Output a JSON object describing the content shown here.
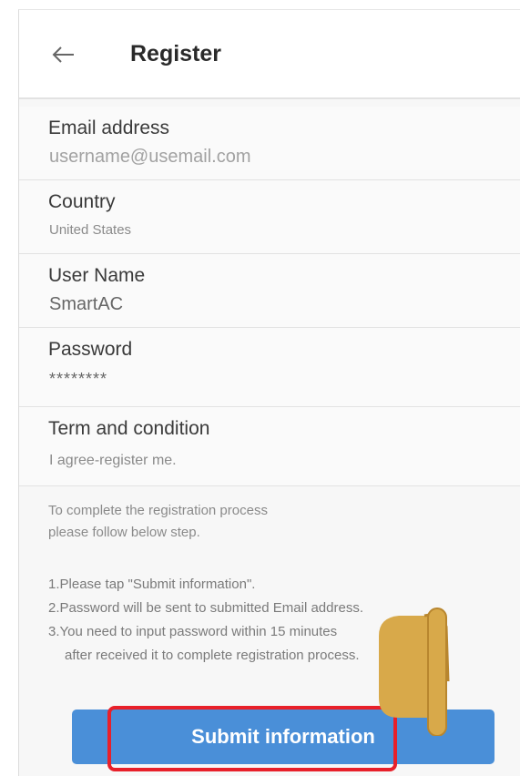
{
  "header": {
    "back_icon": "back-arrow-icon",
    "title": "Register"
  },
  "form": {
    "email": {
      "label": "Email address",
      "value": "username@usemail.com"
    },
    "country": {
      "label": "Country",
      "value": "United States"
    },
    "user_name": {
      "label": "User Name",
      "value": "SmartAC"
    },
    "password": {
      "label": "Password",
      "value": "********"
    },
    "terms": {
      "label": "Term and condition",
      "value": "I agree-register me."
    }
  },
  "instructions": {
    "line1": "To complete the registration process",
    "line2": "please follow below step.",
    "step1": "1.Please tap \"Submit information\".",
    "step2": "2.Password will be sent to submitted Email address.",
    "step3": "3.You need to input password within 15 minutes",
    "step3b": "after received it to complete registration process."
  },
  "submit": {
    "label": "Submit information"
  },
  "overlay": {
    "highlight_color": "#e8202a",
    "hand_icon": "pointing-hand-icon"
  },
  "colors": {
    "button": "#4a8fd8"
  }
}
